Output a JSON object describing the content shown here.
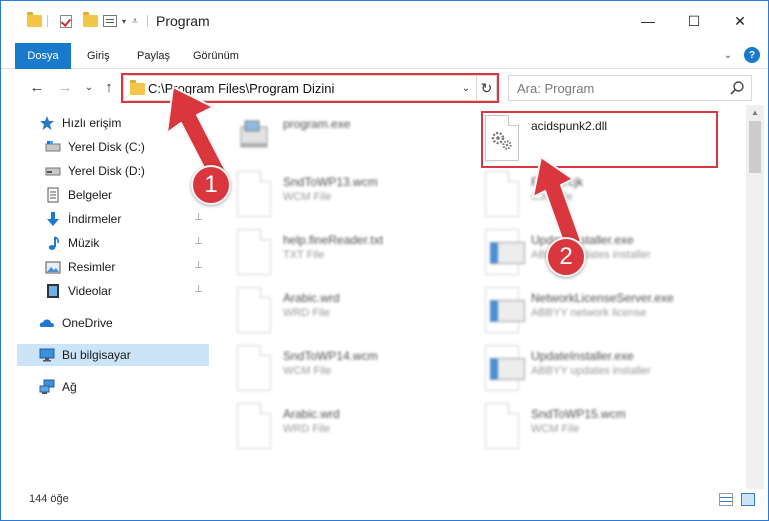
{
  "window": {
    "title": "Program",
    "controls": {
      "minimize": "—",
      "maximize": "☐",
      "close": "✕"
    }
  },
  "ribbon": {
    "tabs": [
      "Dosya",
      "Giriş",
      "Paylaş",
      "Görünüm"
    ],
    "expand": "⌄",
    "help": "?"
  },
  "nav": {
    "back": "←",
    "forward": "→",
    "recent": "⌄",
    "up": "↑",
    "address": "C:\\Program Files\\Program Dizini",
    "address_dropdown": "⌄",
    "refresh": "↻",
    "search_placeholder": "Ara: Program"
  },
  "sidebar": {
    "items": [
      {
        "label": "Hızlı erişim",
        "icon": "star-icon",
        "pinned": false
      },
      {
        "label": "Yerel Disk (C:)",
        "icon": "drive-icon",
        "pinned": true
      },
      {
        "label": "Yerel Disk (D:)",
        "icon": "drive-icon",
        "pinned": true
      },
      {
        "label": "Belgeler",
        "icon": "documents-icon",
        "pinned": true
      },
      {
        "label": "İndirmeler",
        "icon": "download-icon",
        "pinned": true
      },
      {
        "label": "Müzik",
        "icon": "music-icon",
        "pinned": true
      },
      {
        "label": "Resimler",
        "icon": "pictures-icon",
        "pinned": true
      },
      {
        "label": "Videolar",
        "icon": "video-icon",
        "pinned": true
      },
      {
        "label": "OneDrive",
        "icon": "cloud-icon",
        "pinned": false
      },
      {
        "label": "Bu bilgisayar",
        "icon": "computer-icon",
        "pinned": false,
        "selected": true
      },
      {
        "label": "Ağ",
        "icon": "network-icon",
        "pinned": false
      }
    ],
    "pin_glyph": "📌"
  },
  "files": [
    {
      "name": "program.exe",
      "type": "",
      "icon": "exe-icon",
      "col": 0,
      "row": 0,
      "blurred": true
    },
    {
      "name": "acidspunk2.dll",
      "type": "",
      "icon": "dll-gear-icon",
      "col": 1,
      "row": 0,
      "blurred": false
    },
    {
      "name": "SndToWP13.wcm",
      "type": "WCM File",
      "icon": "file-icon",
      "col": 0,
      "row": 1,
      "blurred": true
    },
    {
      "name": "Fretml.cjk",
      "type": "CJK File",
      "icon": "file-icon",
      "col": 1,
      "row": 1,
      "blurred": true
    },
    {
      "name": "help.fineReader.txt",
      "type": "TXT File",
      "icon": "file-icon",
      "col": 0,
      "row": 2,
      "blurred": true
    },
    {
      "name": "UpdateInstaller.exe",
      "type": "ABBYY updates installer",
      "icon": "app-icon",
      "col": 1,
      "row": 2,
      "blurred": true
    },
    {
      "name": "Arabic.wrd",
      "type": "WRD File",
      "icon": "file-icon",
      "col": 0,
      "row": 3,
      "blurred": true
    },
    {
      "name": "NetworkLicenseServer.exe",
      "type": "ABBYY network license",
      "icon": "app-icon",
      "col": 1,
      "row": 3,
      "blurred": true
    },
    {
      "name": "SndToWP14.wcm",
      "type": "WCM File",
      "icon": "file-icon",
      "col": 0,
      "row": 4,
      "blurred": true
    },
    {
      "name": "UpdateInstaller.exe",
      "type": "ABBYY updates installer",
      "icon": "app-icon",
      "col": 1,
      "row": 4,
      "blurred": true
    },
    {
      "name": "Arabic.wrd",
      "type": "WRD File",
      "icon": "file-icon",
      "col": 0,
      "row": 5,
      "blurred": true
    },
    {
      "name": "SndToWP15.wcm",
      "type": "WCM File",
      "icon": "file-icon",
      "col": 1,
      "row": 5,
      "blurred": true
    }
  ],
  "status": {
    "item_count": "144 öğe"
  },
  "annotations": {
    "badge_1": "1",
    "badge_2": "2",
    "color": "#d9363e"
  },
  "colors": {
    "accent": "#1979ca",
    "selection": "#cce4f7",
    "highlight": "#d9363e"
  }
}
